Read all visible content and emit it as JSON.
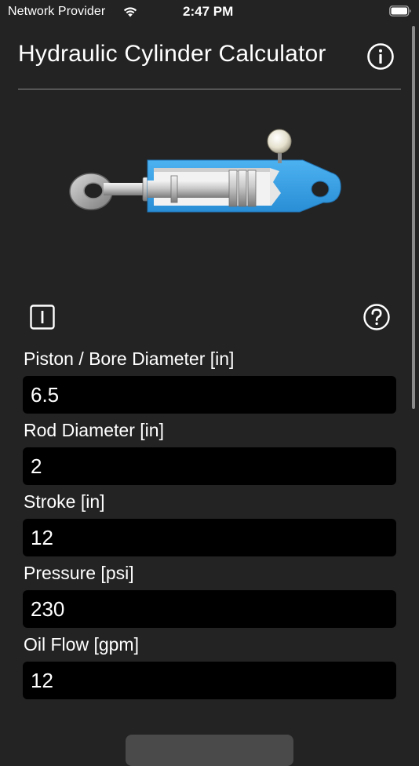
{
  "status_bar": {
    "carrier": "Network Provider",
    "time": "2:47 PM",
    "wifi_icon": "wifi-icon",
    "battery_icon": "battery-icon"
  },
  "nav": {
    "title": "Hydraulic Cylinder Calculator",
    "info_icon": "info-icon"
  },
  "toolbar": {
    "unit_toggle_icon": "unit-toggle-icon",
    "help_icon": "question-mark-icon"
  },
  "colors": {
    "background": "#232323",
    "input_background": "#000000",
    "text": "#ffffff",
    "cylinder_body": "#39a3e8"
  },
  "fields": [
    {
      "id": "piston_bore_diameter",
      "label": "Piston / Bore Diameter [in]",
      "value": "6.5"
    },
    {
      "id": "rod_diameter",
      "label": "Rod Diameter  [in]",
      "value": "2"
    },
    {
      "id": "stroke",
      "label": "Stroke [in]",
      "value": "12"
    },
    {
      "id": "pressure",
      "label": "Pressure [psi]",
      "value": "230"
    },
    {
      "id": "oil_flow",
      "label": "Oil Flow [gpm]",
      "value": "12"
    }
  ]
}
